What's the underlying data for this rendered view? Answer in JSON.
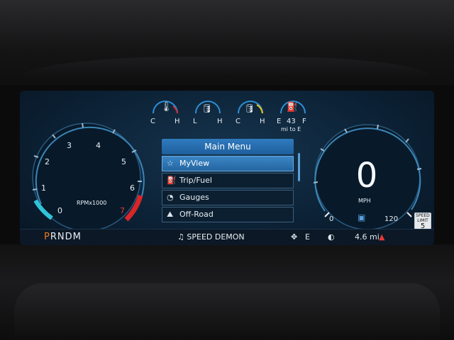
{
  "menu": {
    "title": "Main Menu",
    "items": [
      {
        "label": "MyView",
        "icon": "star-icon",
        "glyph": "☆",
        "selected": true
      },
      {
        "label": "Trip/Fuel",
        "icon": "fuel-pump-icon",
        "glyph": "⛽",
        "selected": false
      },
      {
        "label": "Gauges",
        "icon": "gauge-icon",
        "glyph": "◔",
        "selected": false
      },
      {
        "label": "Off-Road",
        "icon": "off-road-icon",
        "glyph": "⛰",
        "selected": false
      }
    ]
  },
  "tachometer": {
    "unit_label": "RPMx1000",
    "ticks": [
      "0",
      "1",
      "2",
      "3",
      "4",
      "5",
      "6",
      "7"
    ],
    "value": 0,
    "redline_color": "#d8262a",
    "low_color": "#2fc4d9"
  },
  "speedometer": {
    "value": "0",
    "unit": "MPH",
    "min_label": "0",
    "max_label": "120"
  },
  "small_gauges": [
    {
      "icon": "coolant-temp-icon",
      "left": "C",
      "right": "H"
    },
    {
      "icon": "oil-pressure-icon",
      "left": "L",
      "right": "H"
    },
    {
      "icon": "oil-temp-icon",
      "left": "C",
      "right": "H"
    },
    {
      "icon": "fuel-icon",
      "left": "E",
      "right": "F",
      "range_value": "43",
      "range_label": "mi to E"
    }
  ],
  "status_bar": {
    "gear": "PRNDM",
    "gear_active": "P",
    "gear_rest": "RNDM",
    "music_icon": "music-note-icon",
    "track": "SPEED DEMON",
    "compass_icon": "compass-icon",
    "heading": "E",
    "trip_icon": "trip-icon",
    "trip": "4.6 mi",
    "alert_icon": "seatbelt-warning-icon",
    "alert_color": "#e53935"
  },
  "speed_limit": {
    "top": "SPEED",
    "mid": "LIMIT",
    "value": "5"
  }
}
